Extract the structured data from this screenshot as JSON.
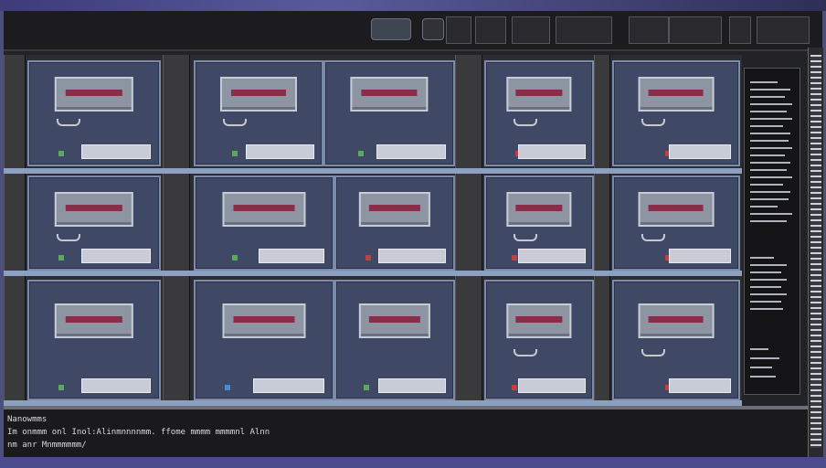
{
  "titlebar": {
    "buttons": [
      "",
      "",
      "",
      ""
    ],
    "readouts": [
      "",
      "",
      ""
    ]
  },
  "status": {
    "line1": "Nanowmms",
    "line2": "Im onmmm onl Inol:Alinmnnnnmm. ffome mmmm mmmmnl Alnn",
    "line3": "nm anr Mnmmmmmm/"
  },
  "cabinets": [
    {
      "id": "c1",
      "tag": ""
    },
    {
      "id": "c2",
      "tag": ""
    },
    {
      "id": "c3",
      "tag": ""
    },
    {
      "id": "c4",
      "tag": ""
    },
    {
      "id": "c5",
      "tag": ""
    },
    {
      "id": "c6",
      "tag": ""
    },
    {
      "id": "c7",
      "tag": ""
    },
    {
      "id": "c8",
      "tag": ""
    },
    {
      "id": "c9",
      "tag": ""
    },
    {
      "id": "c10",
      "tag": ""
    },
    {
      "id": "c11",
      "tag": ""
    },
    {
      "id": "c12",
      "tag": ""
    },
    {
      "id": "c13",
      "tag": ""
    },
    {
      "id": "c14",
      "tag": ""
    },
    {
      "id": "c15",
      "tag": ""
    }
  ],
  "colors": {
    "cabinet_face": "#3f4966",
    "cabinet_border": "#7b8aa8",
    "label_stripe": "#8a2d48",
    "led_green": "#5aa860",
    "led_red": "#c04040"
  }
}
